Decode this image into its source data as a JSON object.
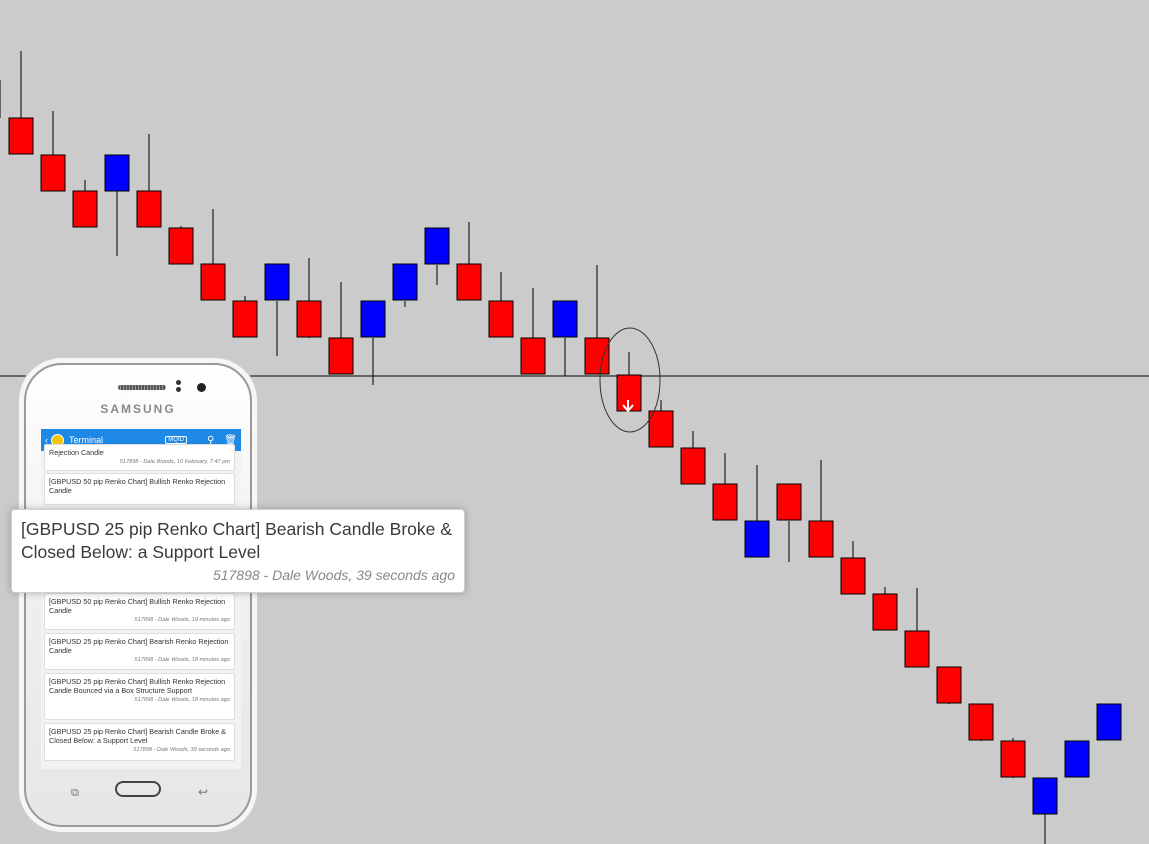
{
  "chart_data": {
    "type": "renko",
    "colors": {
      "bearish": "#ff0000",
      "bullish": "#0000ff",
      "background": "#cbcbcb",
      "wick": "#000000"
    },
    "bricks": [
      {
        "dir": "down"
      },
      {
        "dir": "down"
      },
      {
        "dir": "down"
      },
      {
        "dir": "up"
      },
      {
        "dir": "down"
      },
      {
        "dir": "down"
      },
      {
        "dir": "down"
      },
      {
        "dir": "down"
      },
      {
        "dir": "up"
      },
      {
        "dir": "down"
      },
      {
        "dir": "down"
      },
      {
        "dir": "up"
      },
      {
        "dir": "up"
      },
      {
        "dir": "up"
      },
      {
        "dir": "down"
      },
      {
        "dir": "down"
      },
      {
        "dir": "down"
      },
      {
        "dir": "up"
      },
      {
        "dir": "down"
      },
      {
        "dir": "down"
      },
      {
        "dir": "down"
      },
      {
        "dir": "down"
      },
      {
        "dir": "down"
      },
      {
        "dir": "up"
      },
      {
        "dir": "down"
      },
      {
        "dir": "down"
      },
      {
        "dir": "down"
      },
      {
        "dir": "down"
      },
      {
        "dir": "down"
      },
      {
        "dir": "down"
      },
      {
        "dir": "down"
      },
      {
        "dir": "down"
      },
      {
        "dir": "up"
      },
      {
        "dir": "up"
      },
      {
        "dir": "up"
      }
    ],
    "support_level": "horizontal line",
    "signal": "circled bearish brick with down arrow"
  },
  "phone": {
    "brand": "SAMSUNG",
    "app_title": "Terminal",
    "badge": "MQID",
    "messages": [
      {
        "title": "Rejection Candle",
        "meta": "517898 - Dale Woods, 10 February, 7:47 pm"
      },
      {
        "title": "[GBPUSD 50 pip Renko Chart] Bullish Renko Rejection Candle",
        "meta": ""
      },
      {
        "title": "[GBPUSD 50 pip Renko Chart] Bullish Renko Rejection Candle",
        "meta": "517898 - Dale Woods, 19 minutes ago"
      },
      {
        "title": "[GBPUSD 25 pip Renko Chart] Bearish Renko Rejection Candle",
        "meta": "517898 - Dale Woods, 18 minutes ago"
      },
      {
        "title": "[GBPUSD 25 pip Renko Chart] Bullish Renko Rejection Candle Bounced via a Box Structure Support",
        "meta": "517898 - Dale Woods, 18 minutes ago"
      },
      {
        "title": "[GBPUSD 25 pip Renko Chart] Bearish Candle Broke & Closed Below: a Support Level",
        "meta": "517898 - Dale Woods, 39 seconds ago"
      }
    ]
  },
  "popup": {
    "title": "[GBPUSD 25 pip Renko Chart] Bearish Candle Broke & Closed Below: a Support Level",
    "meta": "517898 - Dale Woods, 39 seconds ago"
  }
}
